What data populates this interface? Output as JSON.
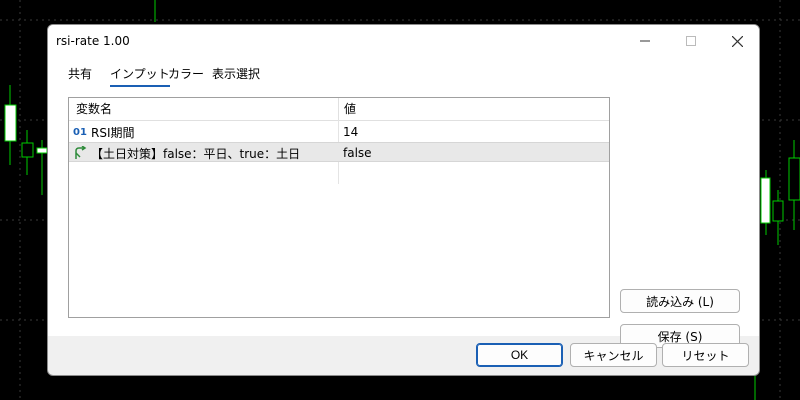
{
  "window": {
    "title": "rsi-rate 1.00"
  },
  "tabs": [
    {
      "label": "共有",
      "active": false
    },
    {
      "label": "インプット",
      "active": true
    },
    {
      "label": "カラー",
      "active": false
    },
    {
      "label": "表示選択",
      "active": false
    }
  ],
  "table": {
    "headers": {
      "name": "変数名",
      "value": "値"
    },
    "rows": [
      {
        "type_icon": "integer-01-icon",
        "type_glyph": "01",
        "name": "RSI期間",
        "value": "14"
      },
      {
        "type_icon": "enum-arrow-icon",
        "type_glyph": "",
        "name": "【土日対策】false：平日、true：土日",
        "value": "false"
      }
    ]
  },
  "side_buttons": {
    "load_label": "読み込み (L)",
    "save_label": "保存 (S)"
  },
  "footer": {
    "ok_label": "OK",
    "cancel_label": "キャンセル",
    "reset_label": "リセット"
  },
  "colors": {
    "accent": "#1a5fb4",
    "candle_green": "#00cc00",
    "chart_background": "#000000"
  }
}
